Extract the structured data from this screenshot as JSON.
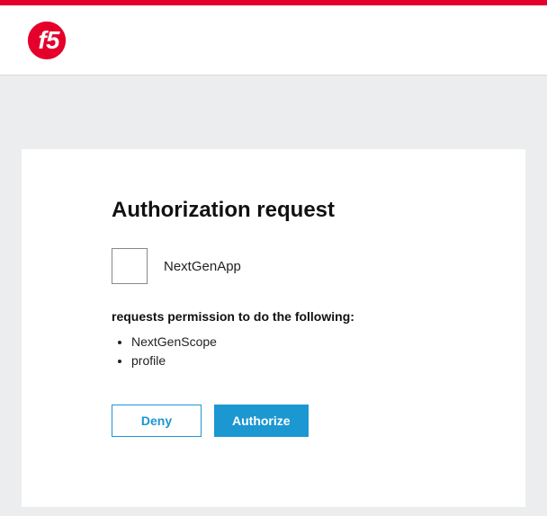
{
  "brand": {
    "accent": "#e4002b",
    "primary_button": "#1b97d1"
  },
  "app": {
    "name": "NextGenApp"
  },
  "title": "Authorization request",
  "permission_intro": "requests permission to do the following:",
  "scopes": [
    "NextGenScope",
    "profile"
  ],
  "buttons": {
    "deny": "Deny",
    "authorize": "Authorize"
  }
}
